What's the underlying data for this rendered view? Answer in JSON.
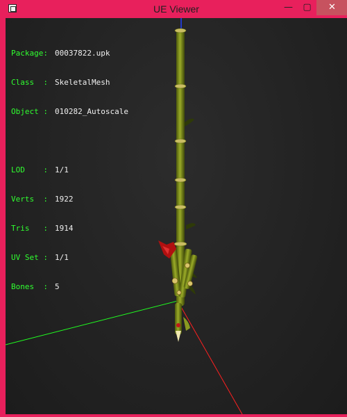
{
  "window": {
    "title": "UE Viewer",
    "controls": {
      "minimize": "—",
      "maximize": "▢",
      "close": "✕"
    }
  },
  "info_panel": {
    "package": {
      "label": "Package:",
      "value": "00037822.upk"
    },
    "class": {
      "label": "Class  :",
      "value": "SkeletalMesh"
    },
    "object": {
      "label": "Object :",
      "value": "010282_Autoscale"
    },
    "lod": {
      "label": "LOD    :",
      "value": "1/1"
    },
    "verts": {
      "label": "Verts  :",
      "value": "1922"
    },
    "tris": {
      "label": "Tris   :",
      "value": "1914"
    },
    "uvset": {
      "label": "UV Set :",
      "value": "1/1"
    },
    "bones": {
      "label": "Bones  :",
      "value": "5"
    }
  },
  "scene": {
    "axis_colors": {
      "x": "#ff2020",
      "y": "#20ff20",
      "z": "#2040ff"
    },
    "mesh_colors": {
      "stalk": "#7a8a18",
      "node": "#c8b85a",
      "accent": "#b01010",
      "leaf": "#3a4a10"
    }
  }
}
